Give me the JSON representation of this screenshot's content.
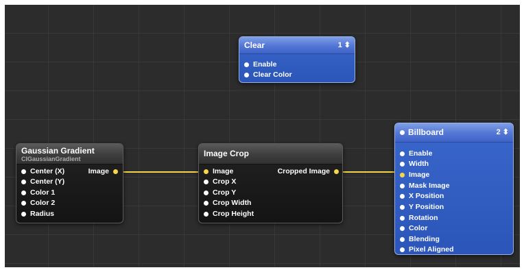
{
  "colors": {
    "canvas_bg": "#2c2c2c",
    "wire": "#f5d64a",
    "dark_node": "#1a1a1a",
    "blue_node": "#2f5cc0"
  },
  "nodes": {
    "clear": {
      "title": "Clear",
      "badge": "1 ⬍",
      "inputs": [
        "Enable",
        "Clear Color"
      ]
    },
    "gaussian": {
      "title": "Gaussian Gradient",
      "subtitle": "CIGaussianGradient",
      "inputs": [
        "Center (X)",
        "Center (Y)",
        "Color 1",
        "Color 2",
        "Radius"
      ],
      "output": "Image"
    },
    "crop": {
      "title": "Image Crop",
      "inputs": [
        "Image",
        "Crop X",
        "Crop Y",
        "Crop Width",
        "Crop Height"
      ],
      "output": "Cropped Image"
    },
    "billboard": {
      "title": "Billboard",
      "badge": "2 ⬍",
      "inputs": [
        "Enable",
        "Width",
        "Image",
        "Mask Image",
        "X Position",
        "Y Position",
        "Rotation",
        "Color",
        "Blending",
        "Pixel Aligned"
      ]
    }
  },
  "connections": [
    {
      "from": "Gaussian Gradient.Image",
      "to": "Image Crop.Image"
    },
    {
      "from": "Image Crop.Cropped Image",
      "to": "Billboard.Image"
    }
  ]
}
